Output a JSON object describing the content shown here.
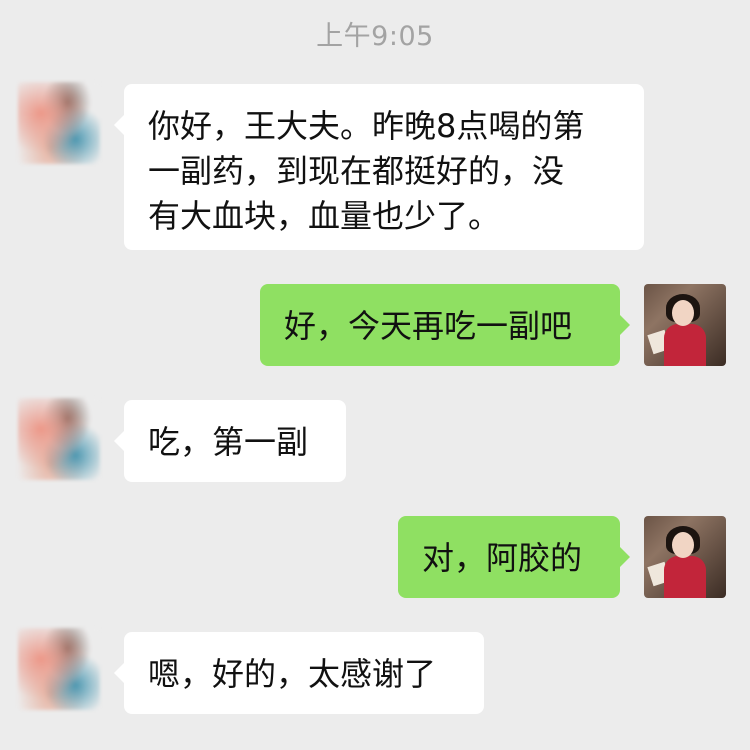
{
  "chat": {
    "timestamp": "上午9:05",
    "messages": [
      {
        "sender": "patient",
        "text": "你好，王大夫。昨晚8点喝的第\n一副药，到现在都挺好的，没\n有大血块，血量也少了。"
      },
      {
        "sender": "doctor",
        "text": "好，今天再吃一副吧"
      },
      {
        "sender": "patient",
        "text": "吃，第一副"
      },
      {
        "sender": "doctor",
        "text": "对，阿胶的"
      },
      {
        "sender": "patient",
        "text": "嗯，好的，太感谢了"
      }
    ]
  },
  "colors": {
    "background": "#ececec",
    "incoming_bubble": "#ffffff",
    "outgoing_bubble": "#8fe062",
    "timestamp_text": "#a3a3a3"
  }
}
